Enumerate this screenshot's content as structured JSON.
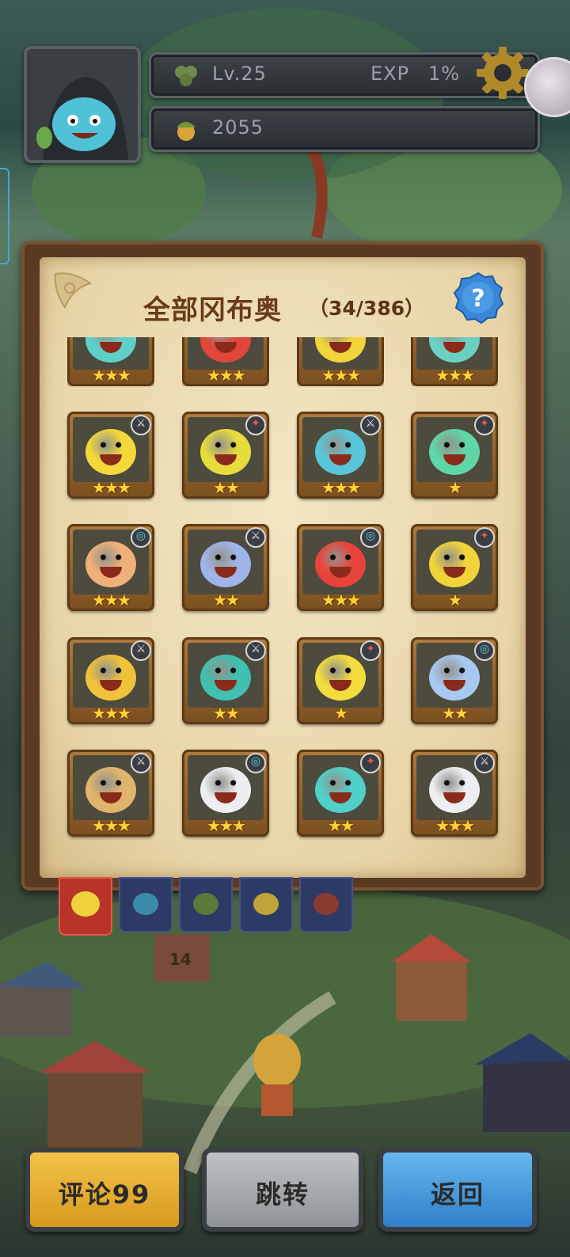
{
  "hud": {
    "level_label": "Lv.25",
    "exp_label": "EXP",
    "exp_value": "1%",
    "coins": "2055"
  },
  "panel": {
    "title": "全部冈布奥",
    "count": "（34/386）"
  },
  "heroes": [
    {
      "stars": 3,
      "color": "#5fd0c8",
      "badge": "none"
    },
    {
      "stars": 3,
      "color": "#e0463a",
      "badge": "none"
    },
    {
      "stars": 3,
      "color": "#f1d53a",
      "badge": "none"
    },
    {
      "stars": 3,
      "color": "#6ad0c2",
      "badge": "none"
    },
    {
      "stars": 3,
      "color": "#f2d83a",
      "badge": "sword"
    },
    {
      "stars": 2,
      "color": "#e6dd3c",
      "badge": "compass"
    },
    {
      "stars": 3,
      "color": "#58c6d8",
      "badge": "sword"
    },
    {
      "stars": 1,
      "color": "#5fd6a8",
      "badge": "compass"
    },
    {
      "stars": 3,
      "color": "#f0b07a",
      "badge": "spiral"
    },
    {
      "stars": 2,
      "color": "#9fb4e8",
      "badge": "sword"
    },
    {
      "stars": 3,
      "color": "#e8433a",
      "badge": "spiral"
    },
    {
      "stars": 1,
      "color": "#f0d43a",
      "badge": "compass"
    },
    {
      "stars": 3,
      "color": "#f0c23a",
      "badge": "sword"
    },
    {
      "stars": 2,
      "color": "#3fc0b0",
      "badge": "sword"
    },
    {
      "stars": 1,
      "color": "#f2dc3e",
      "badge": "compass"
    },
    {
      "stars": 2,
      "color": "#a7c8f0",
      "badge": "spiral"
    },
    {
      "stars": 3,
      "color": "#e0b46a",
      "badge": "sword"
    },
    {
      "stars": 3,
      "color": "#eceef2",
      "badge": "spiral"
    },
    {
      "stars": 2,
      "color": "#4fd0c8",
      "badge": "compass"
    },
    {
      "stars": 3,
      "color": "#eceef2",
      "badge": "sword"
    }
  ],
  "buttons": {
    "comment": "评论99",
    "jump": "跳转",
    "back": "返回"
  },
  "map_sign": "14"
}
